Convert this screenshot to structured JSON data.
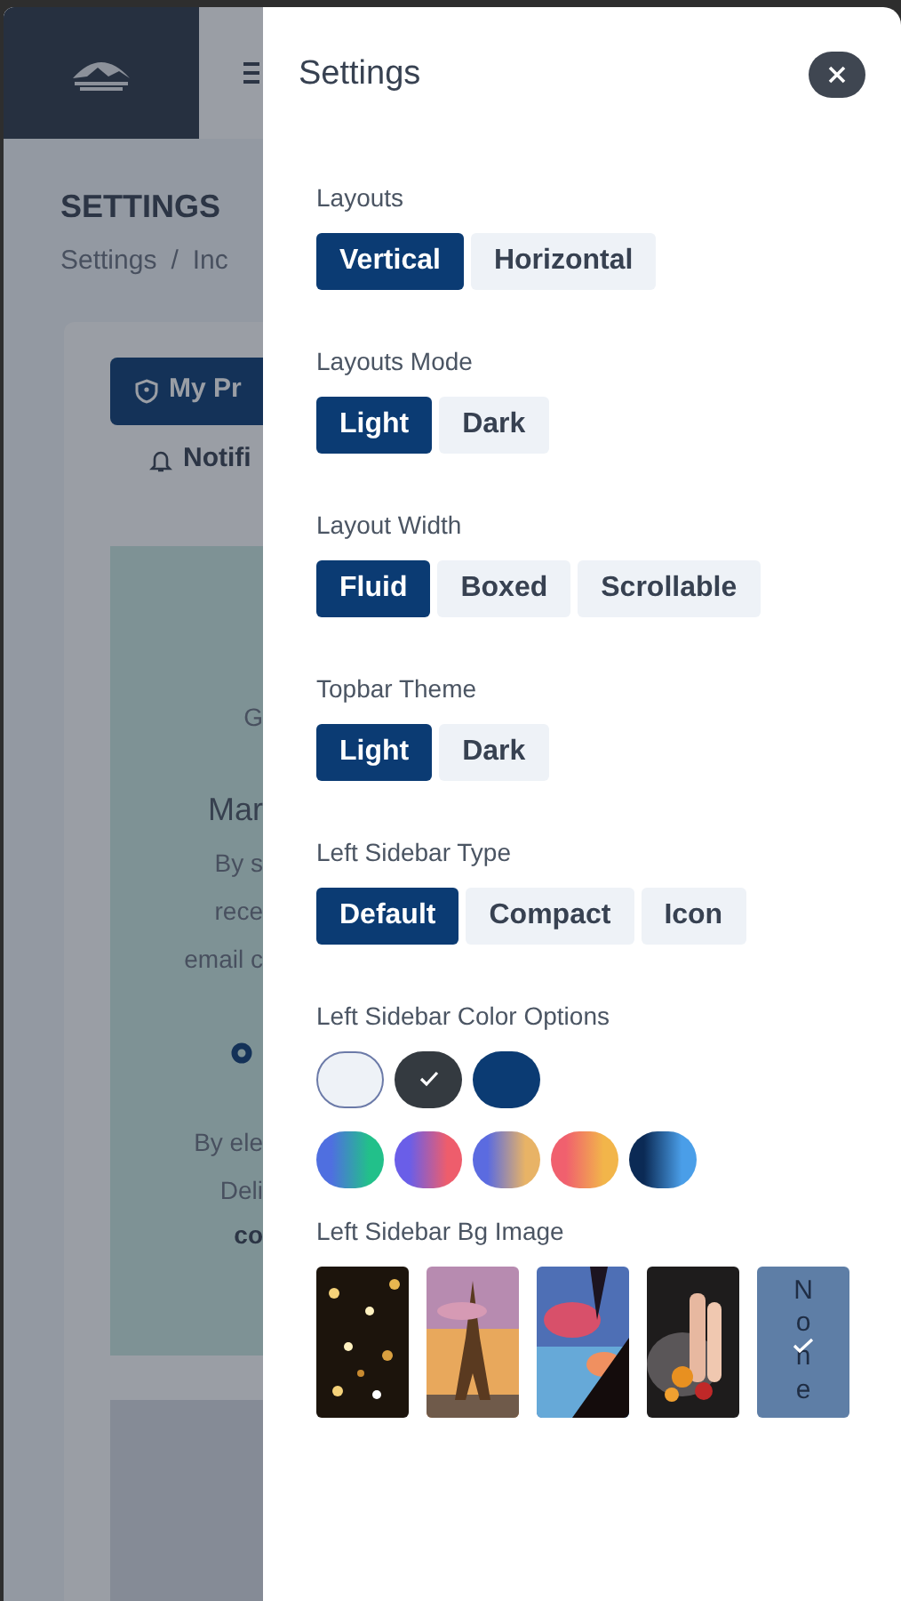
{
  "background_page": {
    "page_title": "SETTINGS",
    "breadcrumb": [
      "Settings",
      "/",
      "Inc"
    ],
    "tabs": [
      {
        "label": "My Pr",
        "selected": true
      },
      {
        "label": "Notifi",
        "selected": false
      }
    ],
    "card_lines": [
      {
        "kind": "text",
        "text": "G"
      },
      {
        "kind": "heading",
        "text": "Mar"
      },
      {
        "kind": "text",
        "text": "By s"
      },
      {
        "kind": "text",
        "text": "rece"
      },
      {
        "kind": "text",
        "text": "email c"
      },
      {
        "kind": "dot"
      },
      {
        "kind": "text",
        "text": "By ele"
      },
      {
        "kind": "text",
        "text": "Deli"
      },
      {
        "kind": "bold",
        "text": "co"
      }
    ]
  },
  "settings_panel": {
    "title": "Settings",
    "sections": [
      {
        "kind": "buttons",
        "label": "Layouts",
        "options": [
          {
            "label": "Vertical",
            "selected": true
          },
          {
            "label": "Horizontal",
            "selected": false
          }
        ]
      },
      {
        "kind": "buttons",
        "label": "Layouts Mode",
        "options": [
          {
            "label": "Light",
            "selected": true
          },
          {
            "label": "Dark",
            "selected": false
          }
        ]
      },
      {
        "kind": "buttons",
        "label": "Layout Width",
        "options": [
          {
            "label": "Fluid",
            "selected": true
          },
          {
            "label": "Boxed",
            "selected": false
          },
          {
            "label": "Scrollable",
            "selected": false
          }
        ]
      },
      {
        "kind": "buttons",
        "label": "Topbar Theme",
        "options": [
          {
            "label": "Light",
            "selected": true
          },
          {
            "label": "Dark",
            "selected": false
          }
        ]
      },
      {
        "kind": "buttons",
        "label": "Left Sidebar Type",
        "options": [
          {
            "label": "Default",
            "selected": true
          },
          {
            "label": "Compact",
            "selected": false
          },
          {
            "label": "Icon",
            "selected": false
          }
        ]
      },
      {
        "kind": "swatches",
        "label": "Left Sidebar Color Options",
        "rows": [
          [
            {
              "color": "#eef2f7",
              "selected": false
            },
            {
              "color": "#343a40",
              "selected": true
            },
            {
              "color": "#0b3b73",
              "selected": false
            }
          ],
          [
            {
              "stops": [
                {
                  "color": "#4f6fe0"
                },
                {
                  "color": "#22c08a"
                }
              ],
              "selected": false
            },
            {
              "stops": [
                {
                  "color": "#6a5ee8"
                },
                {
                  "color": "#ee5d6c"
                }
              ],
              "selected": false
            },
            {
              "stops": [
                {
                  "color": "#5b6be0"
                },
                {
                  "color": "#e8b366"
                }
              ],
              "selected": false
            },
            {
              "stops": [
                {
                  "color": "#f0606e"
                },
                {
                  "color": "#f2b54a"
                }
              ],
              "selected": false
            },
            {
              "stops": [
                {
                  "color": "#0b2a55"
                },
                {
                  "color": "#4a9ee8"
                }
              ],
              "selected": false
            }
          ]
        ]
      },
      {
        "kind": "images",
        "label": "Left Sidebar Bg Image",
        "options": [
          {
            "kind": "picture",
            "selected": false
          },
          {
            "kind": "picture",
            "selected": false
          },
          {
            "kind": "picture",
            "selected": false
          },
          {
            "kind": "picture",
            "selected": false
          },
          {
            "kind": "none",
            "label": "None",
            "selected": true
          }
        ]
      }
    ]
  }
}
